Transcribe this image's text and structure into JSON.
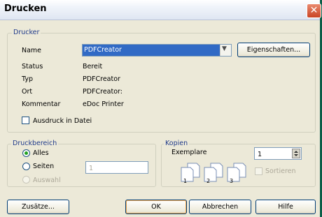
{
  "dialog": {
    "title": "Drucken"
  },
  "printer": {
    "group_label": "Drucker",
    "name_label": "Name",
    "name_value": "PDFCreator",
    "properties_button": "Eigenschaften...",
    "status_label": "Status",
    "status_value": "Bereit",
    "type_label": "Typ",
    "type_value": "PDFCreator",
    "location_label": "Ort",
    "location_value": "PDFCreator:",
    "comment_label": "Kommentar",
    "comment_value": "eDoc Printer",
    "print_to_file_label": "Ausdruck in Datei",
    "print_to_file_checked": false
  },
  "range": {
    "group_label": "Druckbereich",
    "all_label": "Alles",
    "pages_label": "Seiten",
    "selection_label": "Auswahl",
    "selected": "all",
    "pages_value": "1"
  },
  "copies": {
    "group_label": "Kopien",
    "count_label": "Exemplare",
    "count_value": "1",
    "collate_label": "Sortieren",
    "icon_pages": [
      "1",
      "2",
      "3"
    ]
  },
  "buttons": {
    "extras": "Zusätze...",
    "ok": "OK",
    "cancel": "Abbrechen",
    "help": "Hilfe"
  },
  "colors": {
    "title_close": "#c94424",
    "legend": "#1f3a8a",
    "selection": "#316ac5"
  }
}
